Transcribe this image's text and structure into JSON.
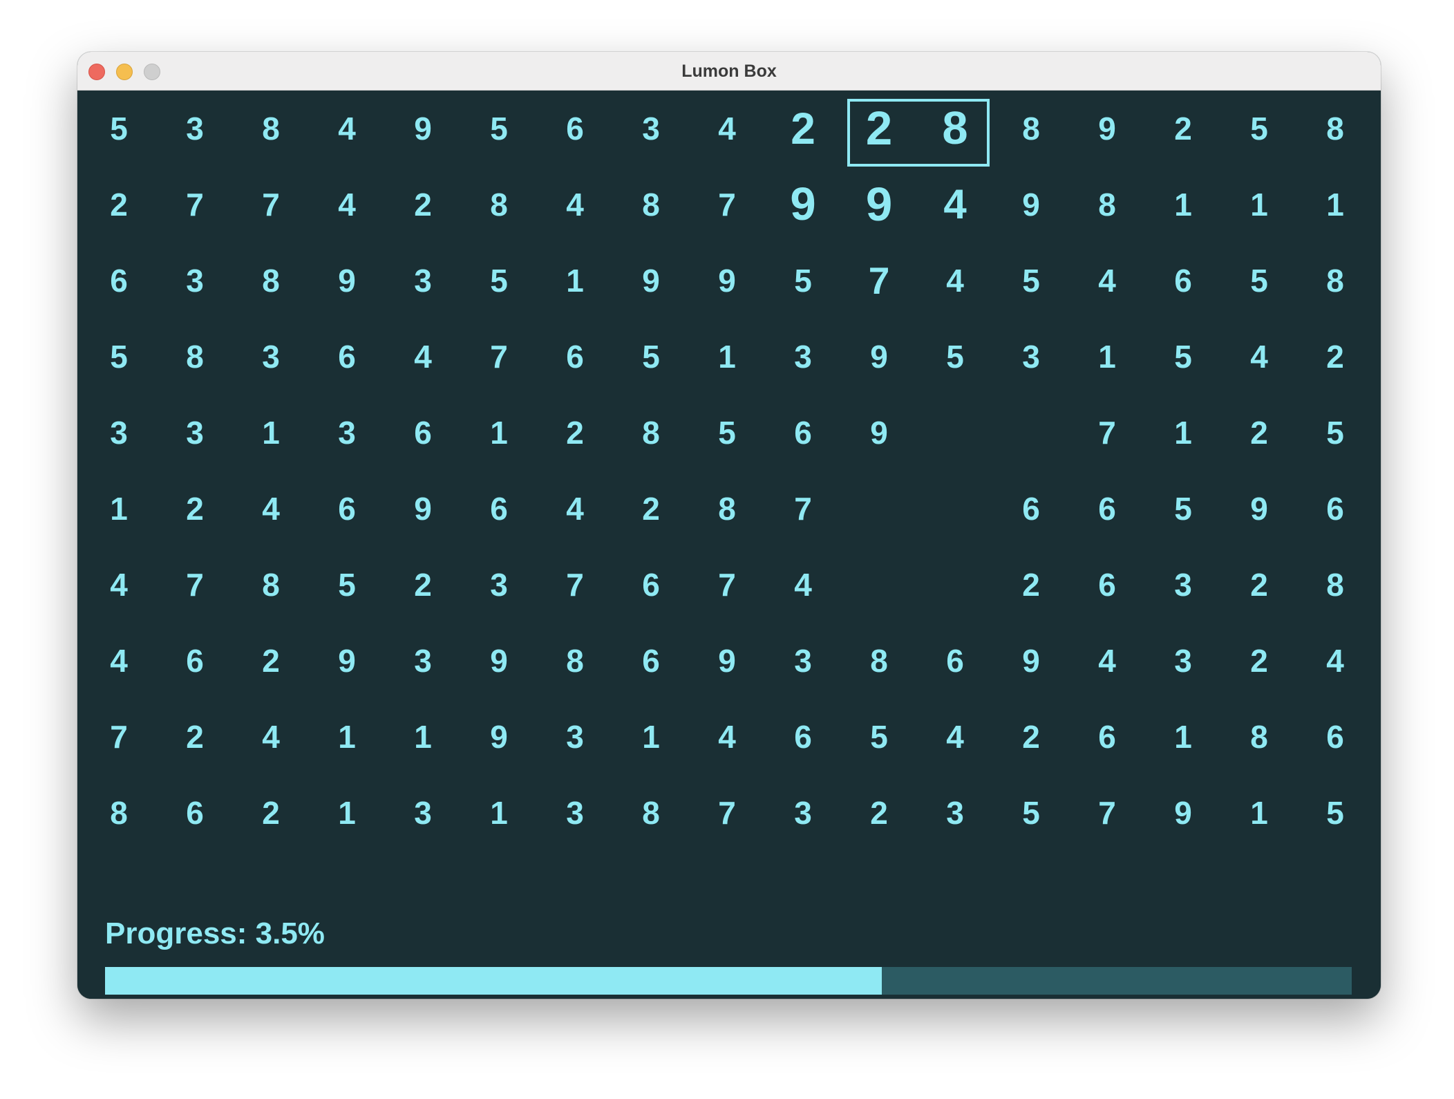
{
  "window": {
    "title": "Lumon Box"
  },
  "grid": {
    "rows": [
      [
        "5",
        "3",
        "8",
        "4",
        "9",
        "5",
        "6",
        "3",
        "4",
        "2",
        "2",
        "8",
        "8",
        "9",
        "2",
        "5",
        "8"
      ],
      [
        "2",
        "7",
        "7",
        "4",
        "2",
        "8",
        "4",
        "8",
        "7",
        "9",
        "9",
        "4",
        "9",
        "8",
        "1",
        "1",
        "1"
      ],
      [
        "6",
        "3",
        "8",
        "9",
        "3",
        "5",
        "1",
        "9",
        "9",
        "5",
        "7",
        "4",
        "5",
        "4",
        "6",
        "5",
        "8"
      ],
      [
        "5",
        "8",
        "3",
        "6",
        "4",
        "7",
        "6",
        "5",
        "1",
        "3",
        "9",
        "5",
        "3",
        "1",
        "5",
        "4",
        "2"
      ],
      [
        "3",
        "3",
        "1",
        "3",
        "6",
        "1",
        "2",
        "8",
        "5",
        "6",
        "9",
        "",
        "",
        "7",
        "1",
        "2",
        "5"
      ],
      [
        "1",
        "2",
        "4",
        "6",
        "9",
        "6",
        "4",
        "2",
        "8",
        "7",
        "",
        "",
        "6",
        "6",
        "5",
        "9",
        "6"
      ],
      [
        "4",
        "7",
        "8",
        "5",
        "2",
        "3",
        "7",
        "6",
        "7",
        "4",
        "",
        "",
        "2",
        "6",
        "3",
        "2",
        "8"
      ],
      [
        "4",
        "6",
        "2",
        "9",
        "3",
        "9",
        "8",
        "6",
        "9",
        "3",
        "8",
        "6",
        "9",
        "4",
        "3",
        "2",
        "4"
      ],
      [
        "7",
        "2",
        "4",
        "1",
        "1",
        "9",
        "3",
        "1",
        "4",
        "6",
        "5",
        "4",
        "2",
        "6",
        "1",
        "8",
        "6"
      ],
      [
        "8",
        "6",
        "2",
        "1",
        "3",
        "1",
        "3",
        "8",
        "7",
        "3",
        "2",
        "3",
        "5",
        "7",
        "9",
        "1",
        "5"
      ]
    ],
    "enlarged": [
      {
        "row": 0,
        "col": 9,
        "scale": 1.4
      },
      {
        "row": 0,
        "col": 10,
        "scale": 1.5
      },
      {
        "row": 0,
        "col": 11,
        "scale": 1.45
      },
      {
        "row": 1,
        "col": 9,
        "scale": 1.45
      },
      {
        "row": 1,
        "col": 10,
        "scale": 1.5
      },
      {
        "row": 1,
        "col": 11,
        "scale": 1.3
      },
      {
        "row": 2,
        "col": 10,
        "scale": 1.2
      }
    ],
    "selected_cells": [
      [
        0,
        10
      ],
      [
        0,
        11
      ]
    ]
  },
  "progress": {
    "label": "Progress: 3.5%",
    "fill_fraction": 0.623
  },
  "colors": {
    "accent": "#8fe9f3",
    "background": "#1a2f34",
    "track": "#2c5b63"
  }
}
